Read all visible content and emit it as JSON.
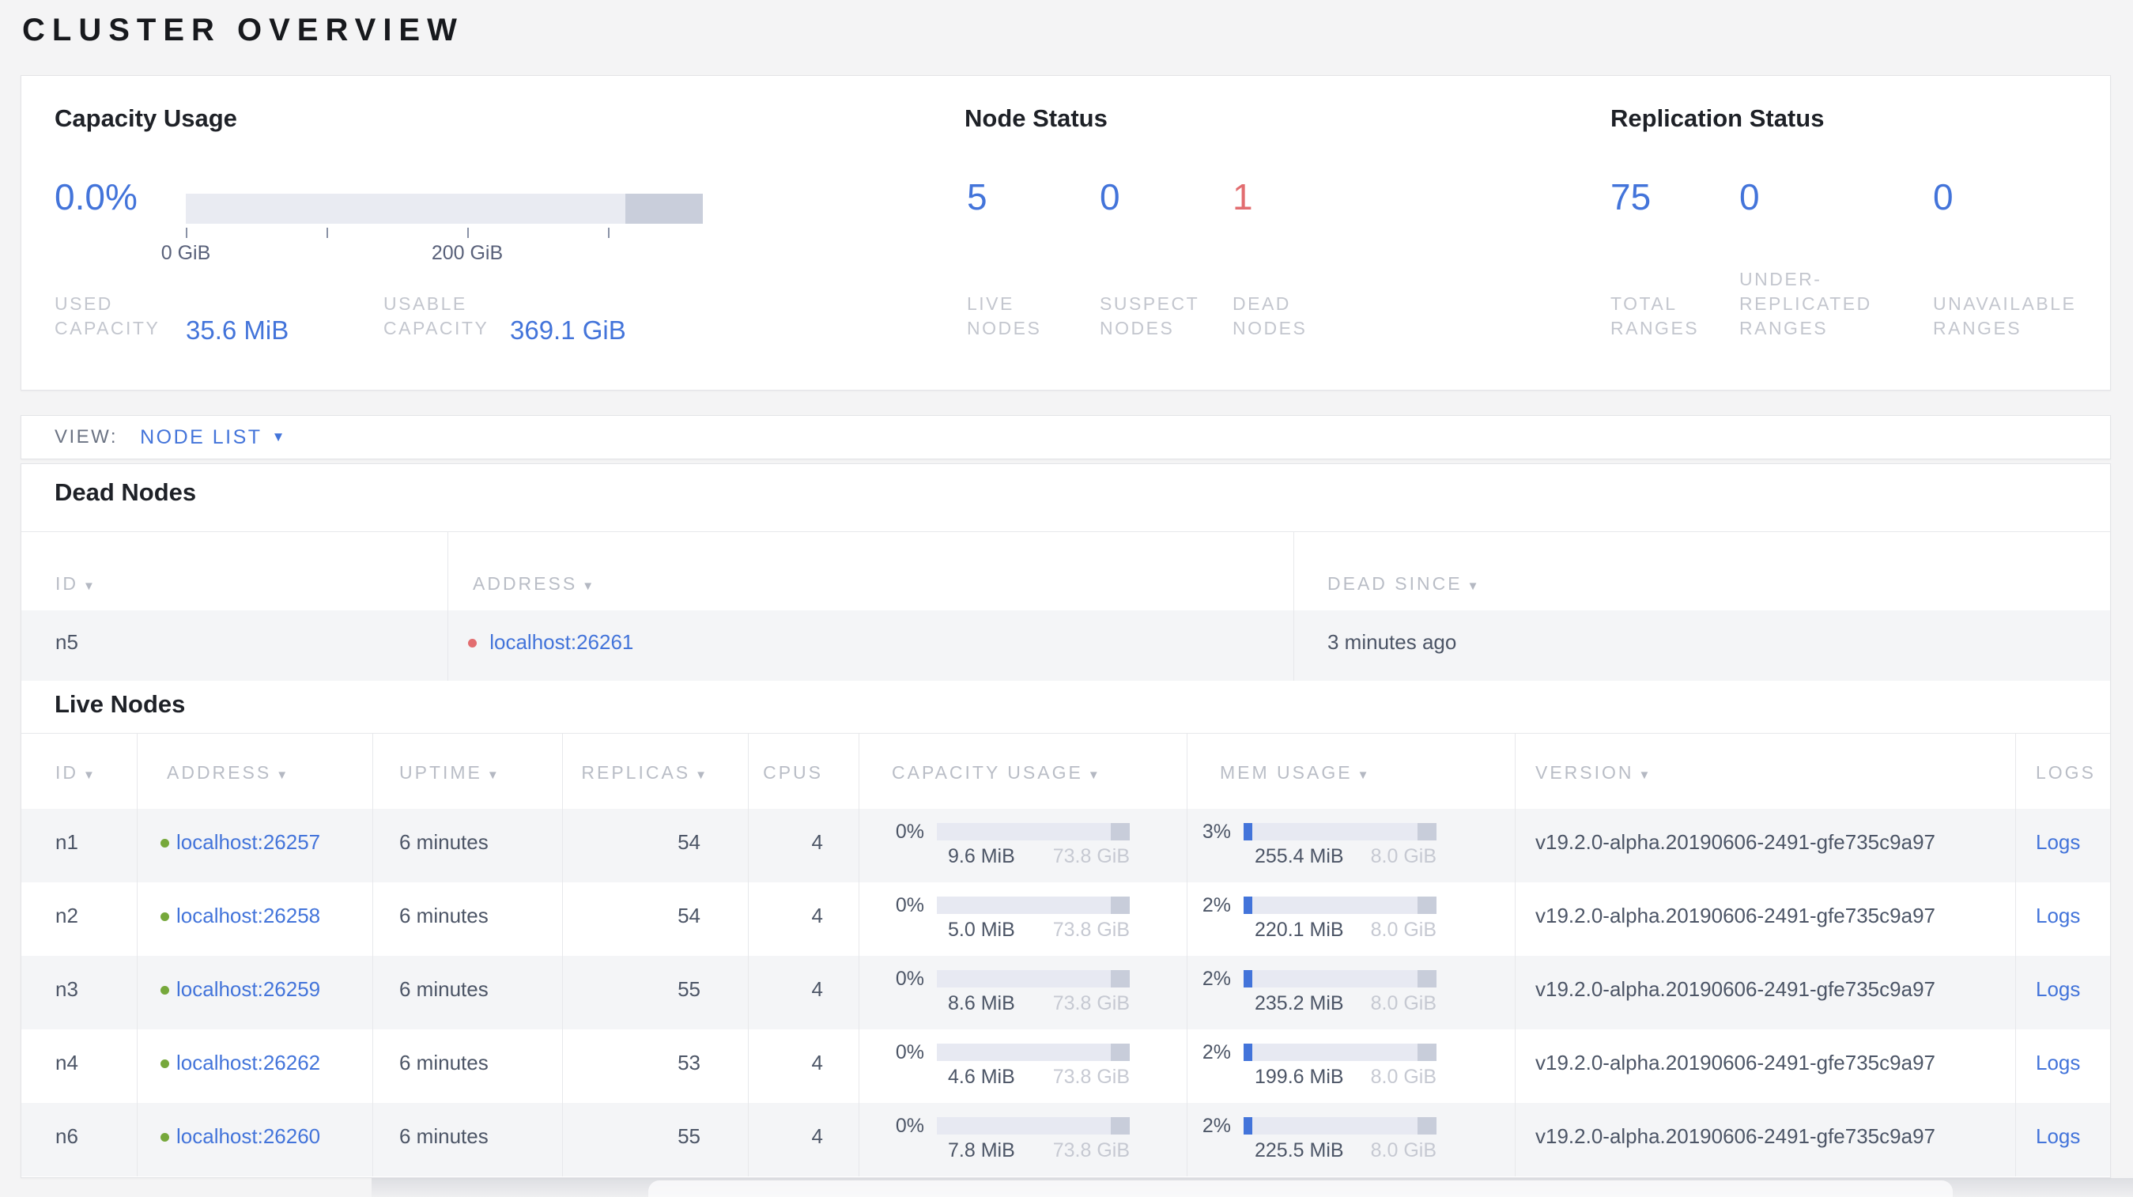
{
  "icons": {
    "sort_desc": "▼",
    "caret_down": "▼"
  },
  "colors": {
    "accent_blue": "#4374da",
    "danger_red": "#e26d70",
    "live_green": "#76a83b"
  },
  "page_title": "CLUSTER OVERVIEW",
  "summary": {
    "capacity_usage": {
      "title": "Capacity Usage",
      "percent": "0.0%",
      "percent_value": 0,
      "axis": {
        "tick_labels": [
          "0 GiB",
          "200 GiB"
        ],
        "tick_values_gib": [
          0,
          100,
          200,
          300
        ],
        "max_gib": 368
      },
      "used_label": "USED CAPACITY",
      "used_value": "35.6 MiB",
      "usable_label": "USABLE CAPACITY",
      "usable_value": "369.1 GiB"
    },
    "node_status": {
      "title": "Node Status",
      "stats": [
        {
          "value": "5",
          "label": "LIVE NODES"
        },
        {
          "value": "0",
          "label": "SUSPECT NODES"
        },
        {
          "value": "1",
          "label": "DEAD NODES"
        }
      ]
    },
    "replication_status": {
      "title": "Replication Status",
      "stats": [
        {
          "value": "75",
          "label": "TOTAL RANGES"
        },
        {
          "value": "0",
          "label": "UNDER-REPLICATED RANGES"
        },
        {
          "value": "0",
          "label": "UNAVAILABLE RANGES"
        }
      ]
    }
  },
  "view_bar": {
    "label": "VIEW:",
    "selected": "NODE LIST"
  },
  "dead_nodes": {
    "title": "Dead Nodes",
    "columns": [
      "ID",
      "ADDRESS",
      "DEAD SINCE"
    ],
    "rows": [
      {
        "id": "n5",
        "address": "localhost:26261",
        "dead_since": "3 minutes ago"
      }
    ]
  },
  "live_nodes": {
    "title": "Live Nodes",
    "columns": [
      "ID",
      "ADDRESS",
      "UPTIME",
      "REPLICAS",
      "CPUS",
      "CAPACITY USAGE",
      "MEM USAGE",
      "VERSION",
      "LOGS"
    ],
    "rows": [
      {
        "id": "n1",
        "address": "localhost:26257",
        "uptime": "6 minutes",
        "replicas": "54",
        "cpus": "4",
        "capacity": {
          "percent": "0%",
          "percent_value": 0,
          "used": "9.6 MiB",
          "total": "73.8 GiB"
        },
        "memory": {
          "percent": "3%",
          "percent_value": 3,
          "used": "255.4 MiB",
          "total": "8.0 GiB"
        },
        "version": "v19.2.0-alpha.20190606-2491-gfe735c9a97",
        "logs_label": "Logs"
      },
      {
        "id": "n2",
        "address": "localhost:26258",
        "uptime": "6 minutes",
        "replicas": "54",
        "cpus": "4",
        "capacity": {
          "percent": "0%",
          "percent_value": 0,
          "used": "5.0 MiB",
          "total": "73.8 GiB"
        },
        "memory": {
          "percent": "2%",
          "percent_value": 2,
          "used": "220.1 MiB",
          "total": "8.0 GiB"
        },
        "version": "v19.2.0-alpha.20190606-2491-gfe735c9a97",
        "logs_label": "Logs"
      },
      {
        "id": "n3",
        "address": "localhost:26259",
        "uptime": "6 minutes",
        "replicas": "55",
        "cpus": "4",
        "capacity": {
          "percent": "0%",
          "percent_value": 0,
          "used": "8.6 MiB",
          "total": "73.8 GiB"
        },
        "memory": {
          "percent": "2%",
          "percent_value": 2,
          "used": "235.2 MiB",
          "total": "8.0 GiB"
        },
        "version": "v19.2.0-alpha.20190606-2491-gfe735c9a97",
        "logs_label": "Logs"
      },
      {
        "id": "n4",
        "address": "localhost:26262",
        "uptime": "6 minutes",
        "replicas": "53",
        "cpus": "4",
        "capacity": {
          "percent": "0%",
          "percent_value": 0,
          "used": "4.6 MiB",
          "total": "73.8 GiB"
        },
        "memory": {
          "percent": "2%",
          "percent_value": 2,
          "used": "199.6 MiB",
          "total": "8.0 GiB"
        },
        "version": "v19.2.0-alpha.20190606-2491-gfe735c9a97",
        "logs_label": "Logs"
      },
      {
        "id": "n6",
        "address": "localhost:26260",
        "uptime": "6 minutes",
        "replicas": "55",
        "cpus": "4",
        "capacity": {
          "percent": "0%",
          "percent_value": 0,
          "used": "7.8 MiB",
          "total": "73.8 GiB"
        },
        "memory": {
          "percent": "2%",
          "percent_value": 2,
          "used": "225.5 MiB",
          "total": "8.0 GiB"
        },
        "version": "v19.2.0-alpha.20190606-2491-gfe735c9a97",
        "logs_label": "Logs"
      }
    ]
  }
}
